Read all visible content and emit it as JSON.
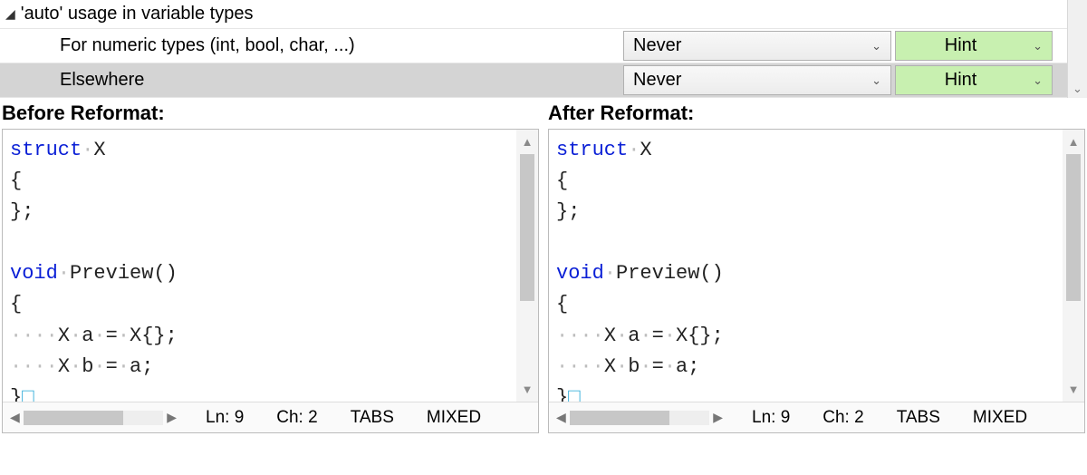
{
  "section": {
    "title": "'auto' usage in variable types"
  },
  "rows": [
    {
      "label": "For numeric types (int, bool, char, ...)",
      "value": "Never",
      "hint": "Hint"
    },
    {
      "label": "Elsewhere",
      "value": "Never",
      "hint": "Hint"
    }
  ],
  "preview": {
    "before_title": "Before Reformat:",
    "after_title": "After Reformat:",
    "status": {
      "ln": "Ln: 9",
      "ch": "Ch: 2",
      "tabs": "TABS",
      "mixed": "MIXED"
    },
    "code": {
      "l1_kw": "struct",
      "l1_rest": "X",
      "l2": "{",
      "l3": "};",
      "l5_kw": "void",
      "l5_rest": "Preview()",
      "l6": "{",
      "l7": "X·a·=·X{};",
      "l8": "X·b·=·a;",
      "l9": "}",
      "dots": "····",
      "dot": "·",
      "end": "□"
    }
  }
}
